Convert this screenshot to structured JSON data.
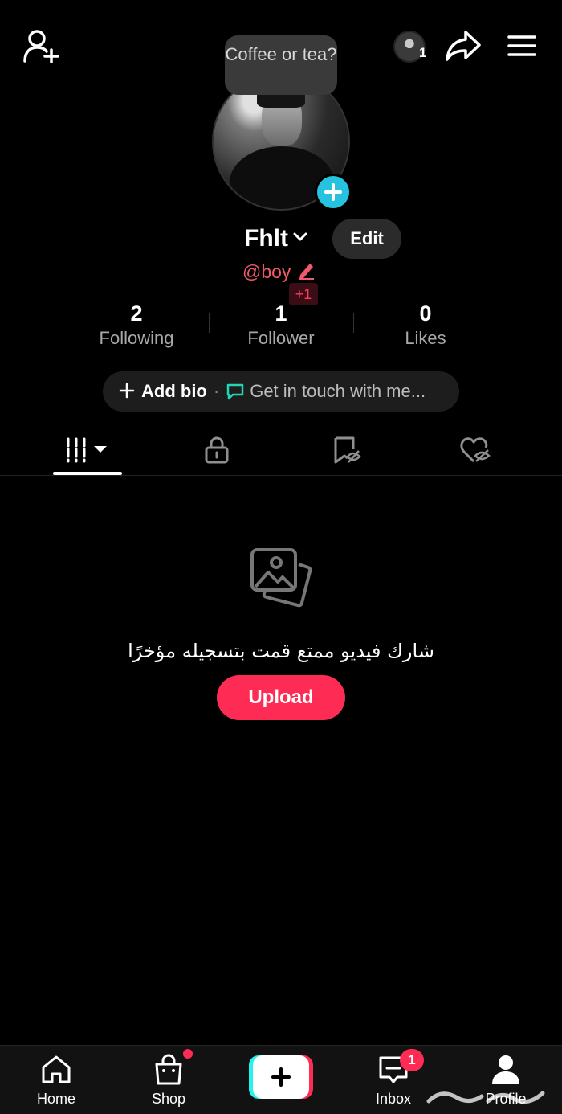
{
  "header": {
    "add_friend_icon": "person-add-icon",
    "viewer_count": "1",
    "share_icon": "share-arrow-icon",
    "menu_icon": "hamburger-menu-icon"
  },
  "tooltip": {
    "text": "Coffee or tea?"
  },
  "profile": {
    "display_name": "Fhlt",
    "edit_label": "Edit",
    "handle": "@boy",
    "handle_badge": "+1"
  },
  "stats": [
    {
      "value": "2",
      "label": "Following"
    },
    {
      "value": "1",
      "label": "Follower"
    },
    {
      "value": "0",
      "label": "Likes"
    }
  ],
  "bio": {
    "add_label": "Add bio",
    "separator": "·",
    "touch_label": "Get in touch with me..."
  },
  "tabs": [
    {
      "name": "videos",
      "icon": "grid-icon",
      "active": true
    },
    {
      "name": "private",
      "icon": "lock-icon",
      "active": false
    },
    {
      "name": "saved",
      "icon": "bookmark-hidden-icon",
      "active": false
    },
    {
      "name": "liked",
      "icon": "heart-hidden-icon",
      "active": false
    }
  ],
  "empty_state": {
    "message": "شارك فيديو ممتع قمت بتسجيله مؤخرًا",
    "upload_label": "Upload"
  },
  "bottom_nav": {
    "home": "Home",
    "shop": "Shop",
    "inbox": "Inbox",
    "inbox_badge": "1",
    "profile": "Profile"
  },
  "colors": {
    "accent_red": "#fe2c55",
    "accent_cyan": "#25f4ee",
    "handle": "#f05a6a",
    "avatar_plus": "#25c3e0"
  }
}
